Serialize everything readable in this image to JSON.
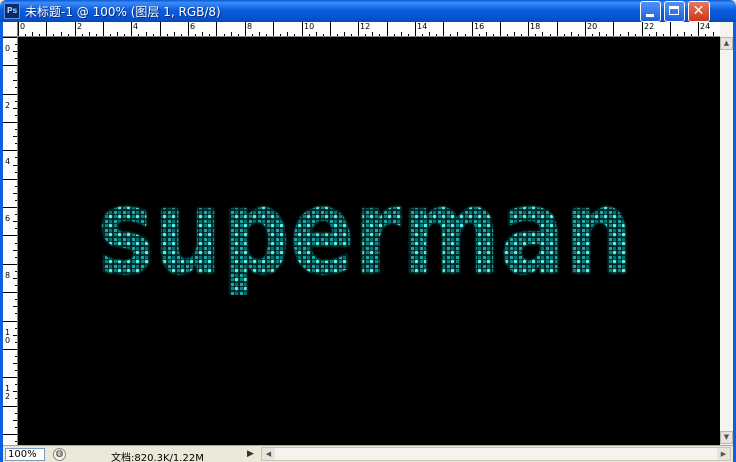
{
  "window": {
    "title": "未标题-1 @ 100% (图层 1, RGB/8)",
    "app_icon_label": "Ps",
    "minimize_icon": "minimize-icon",
    "maximize_icon": "maximize-icon",
    "close_glyph": "✕"
  },
  "rulers": {
    "top_labels": [
      "0",
      "2",
      "4",
      "6",
      "8",
      "10",
      "12",
      "14",
      "16",
      "18",
      "20",
      "22",
      "24"
    ],
    "left_labels": [
      "0",
      "2",
      "4",
      "6",
      "8",
      "1\n0",
      "1\n2"
    ]
  },
  "canvas": {
    "background": "#000000",
    "text": "superman",
    "effect": "cyan glowing dotted mosaic",
    "accent_color": "#2fd6d0"
  },
  "statusbar": {
    "zoom": "100%",
    "doc_info": "文档:820.3K/1.22M",
    "play_glyph": "▶",
    "scroll_left_glyph": "◀",
    "scroll_right_glyph": "▶"
  },
  "scrollbar": {
    "up_glyph": "▲",
    "down_glyph": "▼"
  }
}
